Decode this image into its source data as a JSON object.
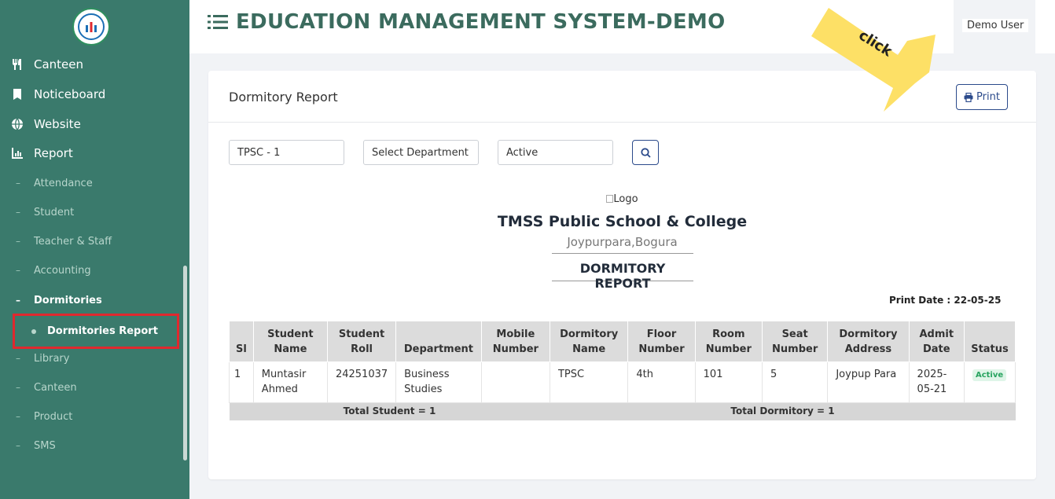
{
  "sidebar": {
    "nav": [
      {
        "label": "Canteen",
        "icon": "utensils-icon"
      },
      {
        "label": "Noticeboard",
        "icon": "bookmark-icon"
      },
      {
        "label": "Website",
        "icon": "globe-icon"
      },
      {
        "label": "Report",
        "icon": "chart-icon"
      }
    ],
    "report_items": [
      "Attendance",
      "Student",
      "Teacher & Staff",
      "Accounting",
      "Dormitories"
    ],
    "selected_sub": "Dormitories Report",
    "after_items": [
      "Library",
      "Canteen",
      "Product",
      "SMS"
    ]
  },
  "header": {
    "title": "EDUCATION MANAGEMENT SYSTEM-DEMO",
    "user": "Demo User"
  },
  "card": {
    "title": "Dormitory Report",
    "print_label": "Print"
  },
  "filters": {
    "class": "TPSC - 1",
    "department": "Select Department",
    "status": "Active"
  },
  "report": {
    "logo_alt": "Logo",
    "school": "TMSS Public School & College",
    "address": "Joypurpara,Bogura",
    "title": "DORMITORY REPORT",
    "print_date": "Print Date : 22-05-25"
  },
  "table": {
    "headers": [
      "Sl",
      "Student Name",
      "Student Roll",
      "Department",
      "Mobile Number",
      "Dormitory Name",
      "Floor Number",
      "Room Number",
      "Seat Number",
      "Dormitory Address",
      "Admit Date",
      "Status"
    ],
    "rows": [
      {
        "sl": "1",
        "name": "Muntasir Ahmed",
        "roll": "24251037",
        "department": "Business Studies",
        "mobile": "",
        "dormitory": "TPSC",
        "floor": "4th",
        "room": "101",
        "seat": "5",
        "address": "Joypup Para",
        "admit_date": "2025-05-21",
        "status": "Active"
      }
    ],
    "total_student": "Total Student = 1",
    "total_dormitory": "Total Dormitory = 1"
  },
  "annotation": {
    "text": "click",
    "color": "#fde066"
  },
  "colors": {
    "sidebar": "#3a7a6c",
    "title": "#3b6b5e",
    "accent": "#2b4a8b",
    "highlight": "#e0282e"
  }
}
